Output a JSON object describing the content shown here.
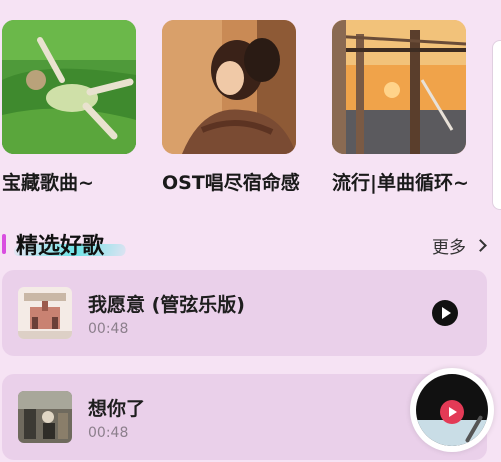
{
  "playlists": [
    {
      "title": "宝藏歌曲~",
      "cover": "girl-on-grass-photo"
    },
    {
      "title": "OST唱尽宿命感",
      "cover": "couple-embrace-photo"
    },
    {
      "title": "流行|单曲循环~",
      "cover": "sunset-dock-photo"
    }
  ],
  "section": {
    "title": "精选好歌",
    "more_label": "更多",
    "accent": "#d94ee0",
    "brush": "#6fe3e7"
  },
  "songs": [
    {
      "title": "我愿意 (管弦乐版)",
      "duration": "00:48",
      "icon": "play-circle-icon"
    },
    {
      "title": "想你了",
      "duration": "00:48",
      "icon": "play-circle-icon"
    }
  ],
  "mini_player": {
    "icon": "vinyl-disc-icon",
    "accent": "#e33a56"
  },
  "colors": {
    "background": "#f6e3f4",
    "card": "#ead0ea"
  }
}
